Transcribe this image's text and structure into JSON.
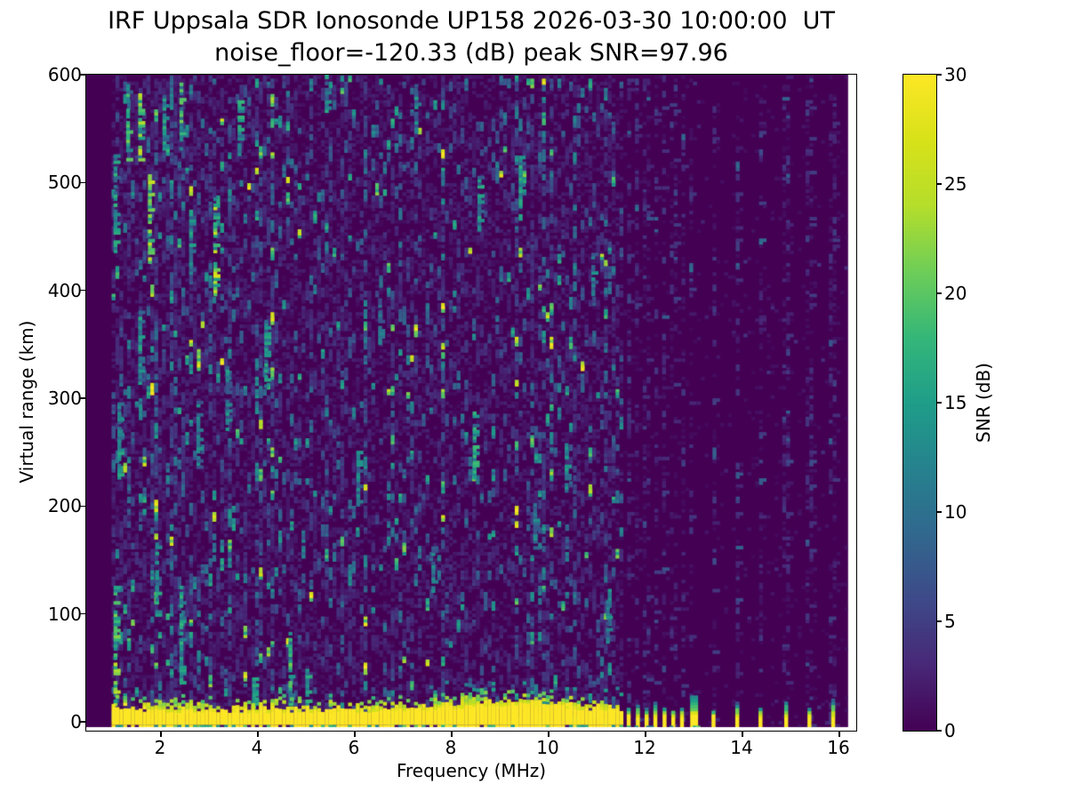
{
  "chart_data": {
    "type": "heatmap",
    "title": "IRF Uppsala SDR Ionosonde UP158 2026-03-30 10:00:00  UT",
    "subtitle": "noise_floor=-120.33 (dB) peak SNR=97.96",
    "station": "IRF Uppsala SDR Ionosonde UP158",
    "timestamp": "2026-03-30 10:00:00 UT",
    "noise_floor_db": -120.33,
    "peak_snr_db": 97.96,
    "xlabel": "Frequency (MHz)",
    "ylabel": "Virtual range (km)",
    "xticks": [
      2,
      4,
      6,
      8,
      10,
      12,
      14,
      16
    ],
    "yticks": [
      0,
      100,
      200,
      300,
      400,
      500,
      600
    ],
    "xlim": [
      0.48,
      16.37
    ],
    "ylim": [
      -5,
      600
    ],
    "data_freq_range": [
      1.0,
      16.2
    ],
    "grid": false,
    "colorbar": {
      "label": "SNR (dB)",
      "ticks": [
        0,
        5,
        10,
        15,
        20,
        25,
        30
      ],
      "vmin": 0,
      "vmax": 30,
      "colormap": "viridis",
      "viridis_stops": [
        [
          0.0,
          "#440154"
        ],
        [
          0.1,
          "#482878"
        ],
        [
          0.2,
          "#3e4a89"
        ],
        [
          0.3,
          "#31688e"
        ],
        [
          0.4,
          "#26828e"
        ],
        [
          0.5,
          "#1f9e89"
        ],
        [
          0.6,
          "#35b779"
        ],
        [
          0.7,
          "#6ece58"
        ],
        [
          0.8,
          "#b5de2b"
        ],
        [
          0.9,
          "#d8e219"
        ],
        [
          1.0,
          "#fde725"
        ]
      ]
    },
    "ground_band": {
      "freq_start": 1.0,
      "freq_end": 11.5,
      "range_km": [
        -3,
        9
      ],
      "snr": 30,
      "fringe_km": 12,
      "bulge_center_mhz": 9.2,
      "bulge_extra_km": 6
    },
    "restricted_transmissions": {
      "frequencies": [
        11.63,
        11.82,
        12.0,
        12.18,
        12.37,
        12.55,
        12.73,
        12.94,
        13.38,
        13.87,
        14.35,
        14.88,
        15.36,
        15.85
      ],
      "cap_km": [
        12,
        15,
        11,
        16,
        12,
        10,
        13,
        24,
        10,
        16,
        13,
        18,
        12,
        20
      ],
      "wide_blip_mhz": 12.94,
      "range_km": [
        -4.3,
        4.5
      ],
      "snr": 30
    },
    "noise": {
      "seed": 20260330,
      "cell_mhz": 0.08,
      "cell_km": 2.85,
      "left_run_start_density": 0.115,
      "left_faint_density": 0.3,
      "right_column_density": 0.13,
      "right_background_density": 0.05,
      "bright_streaks": [
        [
          1.04,
          70,
          55,
          21
        ],
        [
          1.04,
          480,
          45,
          16
        ],
        [
          1.12,
          260,
          35,
          14
        ],
        [
          1.3,
          555,
          35,
          18
        ],
        [
          1.55,
          550,
          30,
          22
        ],
        [
          1.55,
          345,
          35,
          14
        ],
        [
          1.75,
          465,
          40,
          24
        ],
        [
          1.9,
          130,
          35,
          16
        ],
        [
          2.05,
          555,
          25,
          15
        ],
        [
          2.4,
          560,
          30,
          18
        ],
        [
          2.4,
          80,
          45,
          15
        ],
        [
          2.6,
          445,
          30,
          14
        ],
        [
          2.75,
          265,
          30,
          13
        ],
        [
          3.1,
          440,
          45,
          23
        ],
        [
          3.35,
          300,
          30,
          13
        ],
        [
          3.6,
          550,
          25,
          15
        ],
        [
          3.9,
          25,
          18,
          18
        ],
        [
          4.15,
          340,
          30,
          14
        ],
        [
          4.65,
          50,
          35,
          18
        ],
        [
          5.0,
          30,
          15,
          16
        ],
        [
          5.4,
          585,
          20,
          14
        ],
        [
          6.05,
          225,
          25,
          12
        ],
        [
          6.5,
          370,
          20,
          11
        ],
        [
          7.25,
          565,
          25,
          13
        ],
        [
          7.6,
          140,
          20,
          12
        ],
        [
          8.45,
          255,
          30,
          16
        ],
        [
          8.55,
          480,
          25,
          14
        ],
        [
          9.4,
          495,
          30,
          15
        ],
        [
          9.7,
          180,
          20,
          12
        ],
        [
          10.35,
          235,
          25,
          13
        ],
        [
          10.9,
          415,
          20,
          12
        ],
        [
          11.2,
          90,
          20,
          12
        ]
      ]
    }
  }
}
